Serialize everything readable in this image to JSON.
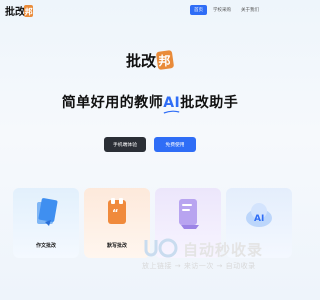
{
  "header": {
    "logo_text": "批改邦",
    "nav": [
      {
        "label": "首页",
        "active": true
      },
      {
        "label": "学校采购",
        "active": false
      },
      {
        "label": "关于我们",
        "active": false
      }
    ]
  },
  "hero": {
    "logo_text": "批改邦",
    "title_before": "简单好用的教师",
    "title_ai": "AI",
    "title_after": "批改助手",
    "primary_button": "手机端体验",
    "secondary_button": "免费使用"
  },
  "features": [
    {
      "label": "作文批改",
      "icon": "essay-doc-icon"
    },
    {
      "label": "默写批改",
      "icon": "quote-book-icon"
    },
    {
      "label": "",
      "icon": "purple-doc-icon"
    },
    {
      "label": "",
      "icon": "cloud-ai-icon"
    }
  ],
  "watermark": {
    "title": "自动秒收录",
    "subtitle": "放上链接 → 来访一次 → 自动收录"
  },
  "colors": {
    "accent": "#2f6df6",
    "dark_button": "#2b2f36",
    "brand_orange": "#e98b3a"
  }
}
